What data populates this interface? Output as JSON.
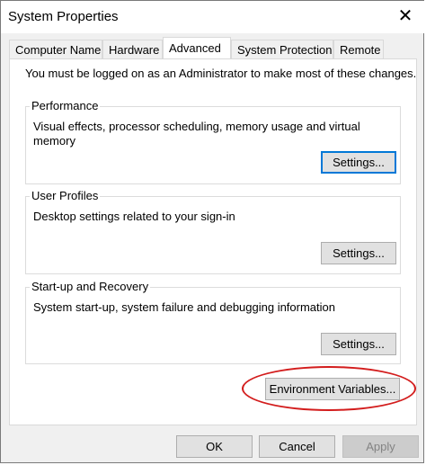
{
  "window": {
    "title": "System Properties",
    "close_glyph": "✕"
  },
  "tabs": [
    {
      "label": "Computer Name"
    },
    {
      "label": "Hardware"
    },
    {
      "label": "Advanced"
    },
    {
      "label": "System Protection"
    },
    {
      "label": "Remote"
    }
  ],
  "active_tab": "Advanced",
  "admin_note": "You must be logged on as an Administrator to make most of these changes.",
  "groups": {
    "performance": {
      "label": "Performance",
      "text": "Visual effects, processor scheduling, memory usage and virtual memory",
      "button": "Settings..."
    },
    "user_profiles": {
      "label": "User Profiles",
      "text": "Desktop settings related to your sign-in",
      "button": "Settings..."
    },
    "startup": {
      "label": "Start-up and Recovery",
      "text": "System start-up, system failure and debugging information",
      "button": "Settings..."
    }
  },
  "env_button": "Environment Variables...",
  "footer": {
    "ok": "OK",
    "cancel": "Cancel",
    "apply": "Apply"
  },
  "colors": {
    "highlight_ellipse": "#d31d1d",
    "focus_border": "#0078d7"
  }
}
